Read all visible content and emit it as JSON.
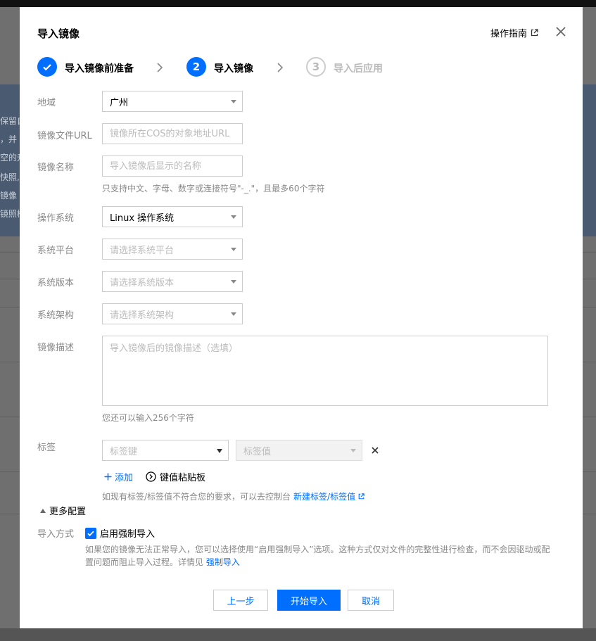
{
  "background": {
    "side_text": [
      "保留自",
      "，并",
      "空的升",
      "快照,",
      "镜像",
      "镜照概"
    ]
  },
  "modal": {
    "title": "导入镜像",
    "guide_link": "操作指南"
  },
  "steps": [
    {
      "number": "1",
      "label": "导入镜像前准备",
      "state": "done"
    },
    {
      "number": "2",
      "label": "导入镜像",
      "state": "active"
    },
    {
      "number": "3",
      "label": "导入后应用",
      "state": "todo"
    }
  ],
  "form": {
    "region": {
      "label": "地域",
      "value": "广州"
    },
    "image_url": {
      "label": "镜像文件URL",
      "placeholder": "镜像所在COS的对象地址URL",
      "value": ""
    },
    "image_name": {
      "label": "镜像名称",
      "placeholder": "导入镜像后显示的名称",
      "value": "",
      "hint": "只支持中文、字母、数字或连接符号\"-_.\"，且最多60个字符"
    },
    "os": {
      "label": "操作系统",
      "value": "Linux 操作系统"
    },
    "platform": {
      "label": "系统平台",
      "placeholder": "请选择系统平台"
    },
    "version": {
      "label": "系统版本",
      "placeholder": "请选择系统版本"
    },
    "arch": {
      "label": "系统架构",
      "placeholder": "请选择系统架构"
    },
    "description": {
      "label": "镜像描述",
      "placeholder": "导入镜像后的镜像描述（选填）",
      "value": "",
      "hint": "您还可以输入256个字符"
    },
    "tags": {
      "label": "标签",
      "key_placeholder": "标签键",
      "value_placeholder": "标签值",
      "add_label": "添加",
      "paste_label": "键值粘贴板",
      "hint": "如现有标签/标签值不符合您的要求，可以去控制台",
      "hint_link": "新建标签/标签值"
    },
    "more_config": "更多配置",
    "import_mode": {
      "label": "导入方式",
      "checkbox_label": "启用强制导入",
      "checked": true,
      "desc_line1": "如果您的镜像无法正常导入，您可以选择使用“启用强制导入”选项。这种方式仅对文件的完整性进行检查，而不会因驱动或配",
      "desc_line2": "置问题而阻止导入过程。详情见",
      "desc_link": "强制导入"
    }
  },
  "footer": {
    "prev": "上一步",
    "start": "开始导入",
    "cancel": "取消"
  },
  "colors": {
    "accent": "#006eff",
    "overlay": "#6f6f6f"
  }
}
